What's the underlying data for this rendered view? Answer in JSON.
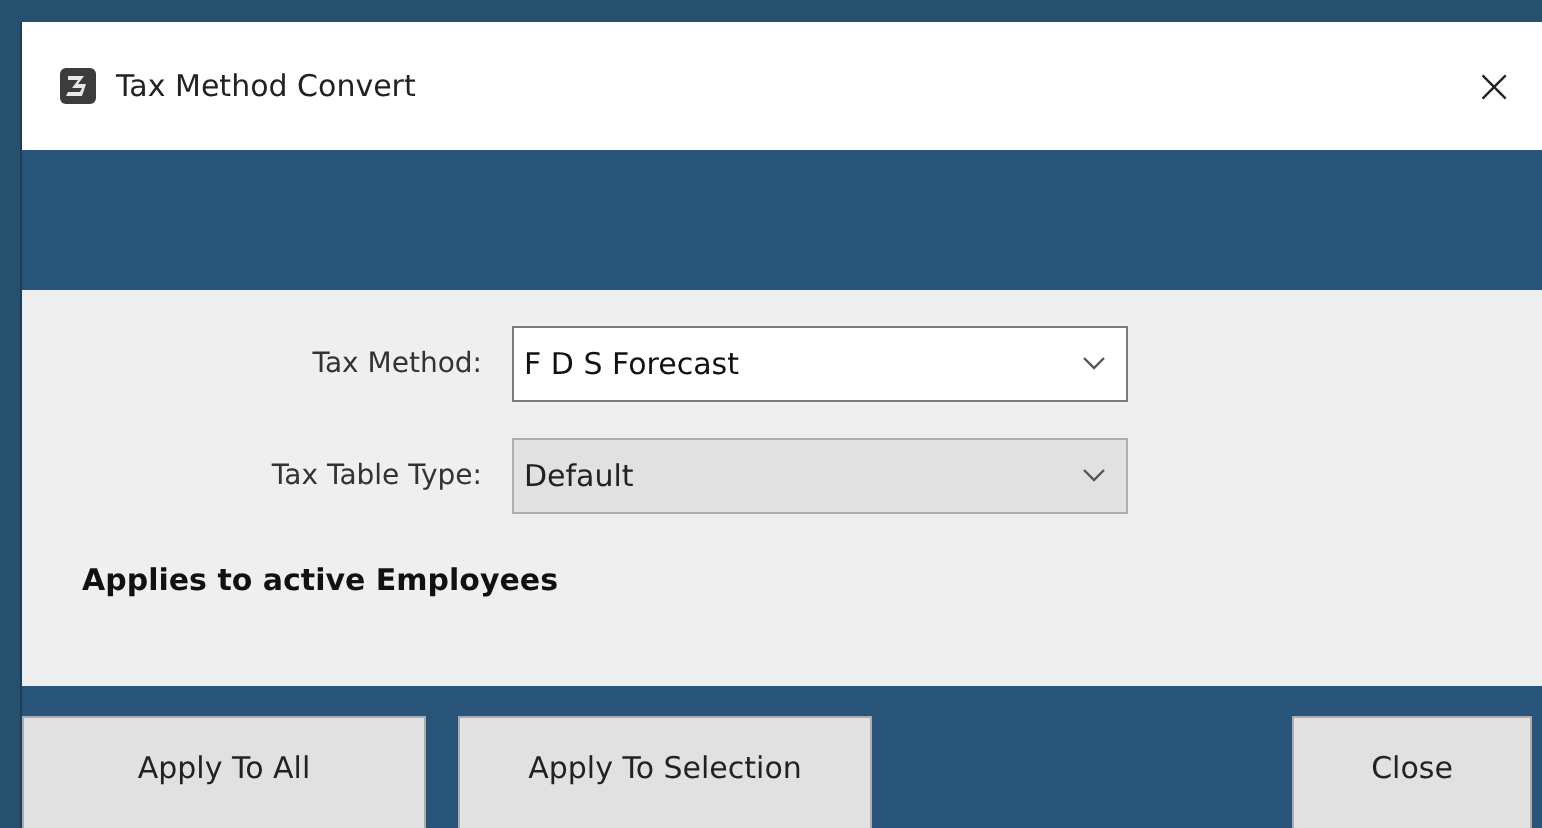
{
  "window": {
    "title": "Tax Method Convert",
    "close": "×"
  },
  "fields": [
    {
      "label": "Tax Method:",
      "value": "F D S Forecast",
      "disabled": false
    },
    {
      "label": "Tax Table Type:",
      "value": "Default",
      "disabled": true
    }
  ],
  "note": "Applies to active Employees",
  "buttons": [
    "Apply To All",
    "Apply To Selection",
    "Close"
  ]
}
